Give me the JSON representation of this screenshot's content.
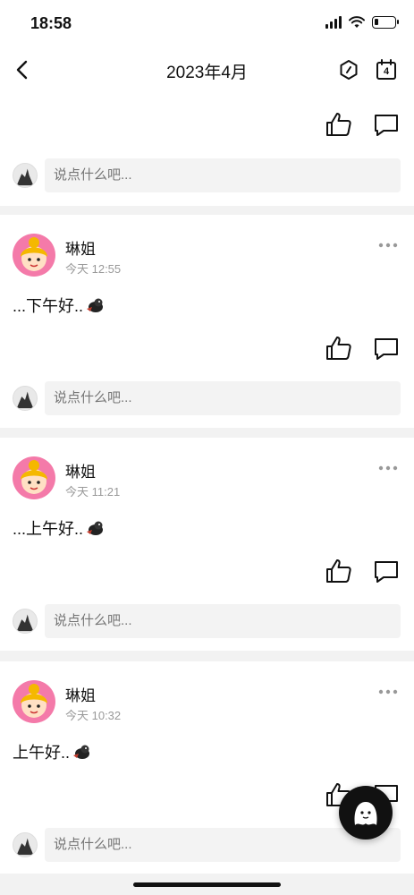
{
  "status_bar": {
    "time": "18:58"
  },
  "nav": {
    "title": "2023年4月"
  },
  "comment_placeholder": "说点什么吧...",
  "posts": [
    {
      "author": "琳姐",
      "time": "今天 12:55",
      "text": "...下午好.."
    },
    {
      "author": "琳姐",
      "time": "今天 11:21",
      "text": "...上午好.."
    },
    {
      "author": "琳姐",
      "time": "今天 10:32",
      "text": "上午好.."
    }
  ],
  "calendar_day": "4",
  "colors": {
    "avatar_bg": "#f47aa9",
    "input_bg": "#f3f3f3",
    "divider": "#f2f2f2"
  }
}
